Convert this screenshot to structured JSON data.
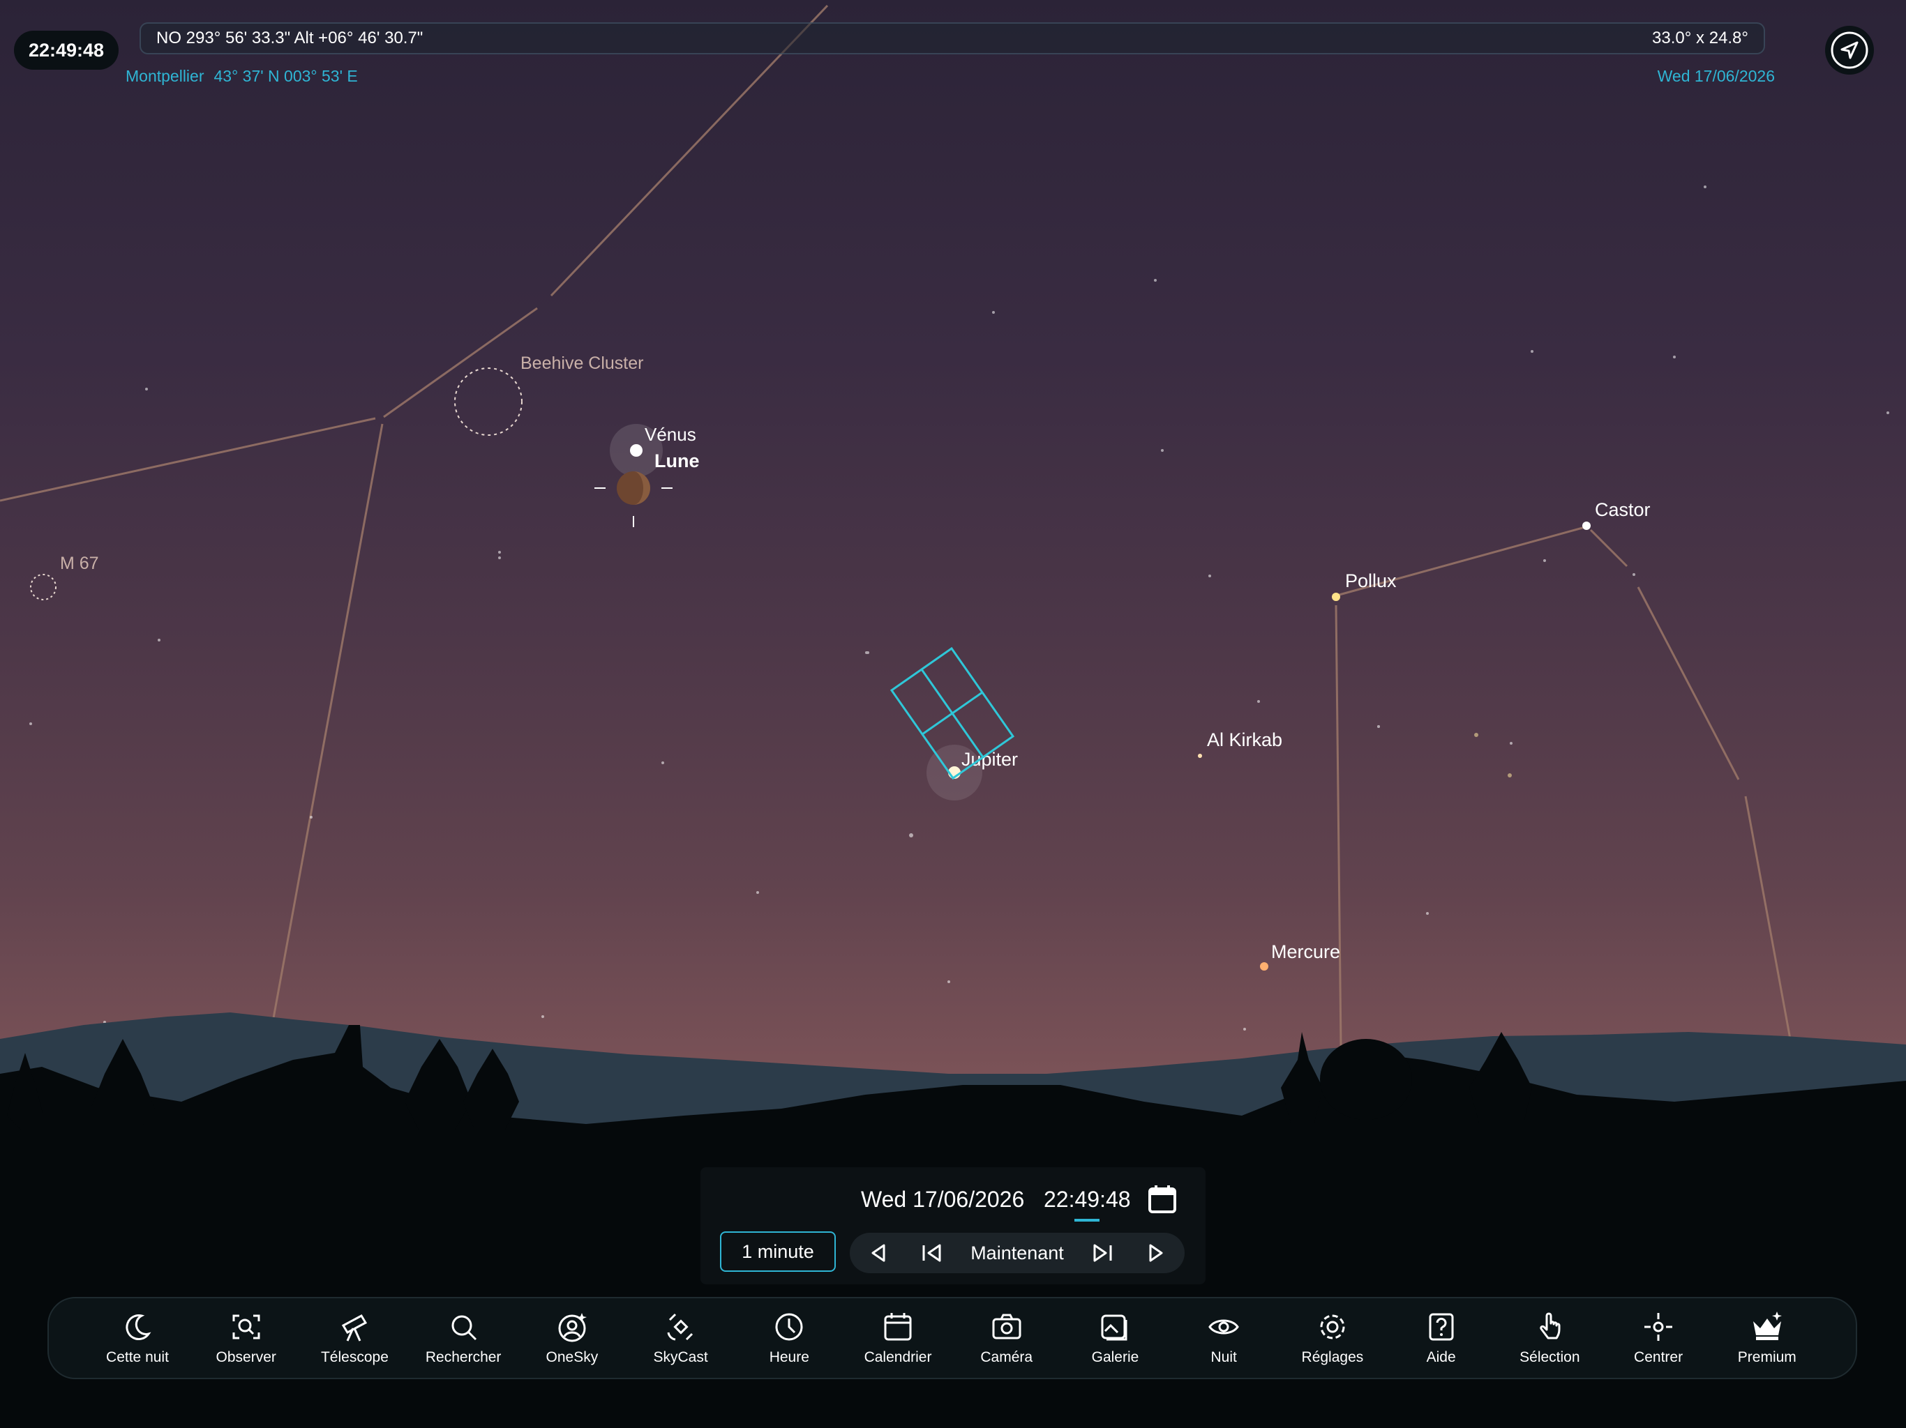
{
  "status": {
    "clock": "22:49:48"
  },
  "header": {
    "pointing": "NO 293° 56' 33.3\" Alt +06° 46' 30.7\"",
    "field_of_view": "33.0° x 24.8°",
    "location_name": "Montpellier",
    "location_coords": "43° 37' N 003° 53' E",
    "date": "Wed 17/06/2026"
  },
  "sky_labels": {
    "beehive": "Beehive Cluster",
    "m67": "M 67",
    "venus": "Vénus",
    "moon": "Lune",
    "castor": "Castor",
    "pollux": "Pollux",
    "al_kirkab": "Al Kirkab",
    "jupiter": "Jupiter",
    "mercure": "Mercure"
  },
  "time_panel": {
    "date": "Wed 17/06/2026",
    "time": "22:49:48",
    "step": "1 minute",
    "now": "Maintenant"
  },
  "toolbar": [
    {
      "label": "Cette nuit",
      "icon": "moon-icon"
    },
    {
      "label": "Observer",
      "icon": "observe-icon"
    },
    {
      "label": "Télescope",
      "icon": "telescope-icon"
    },
    {
      "label": "Rechercher",
      "icon": "search-icon"
    },
    {
      "label": "OneSky",
      "icon": "onesky-icon"
    },
    {
      "label": "SkyCast",
      "icon": "satellite-icon"
    },
    {
      "label": "Heure",
      "icon": "clock-icon"
    },
    {
      "label": "Calendrier",
      "icon": "calendar-icon"
    },
    {
      "label": "Caméra",
      "icon": "camera-icon"
    },
    {
      "label": "Galerie",
      "icon": "gallery-icon"
    },
    {
      "label": "Nuit",
      "icon": "night-eye-icon"
    },
    {
      "label": "Réglages",
      "icon": "gear-icon"
    },
    {
      "label": "Aide",
      "icon": "help-icon"
    },
    {
      "label": "Sélection",
      "icon": "hand-pointer-icon"
    },
    {
      "label": "Centrer",
      "icon": "center-target-icon"
    },
    {
      "label": "Premium",
      "icon": "crown-icon"
    }
  ],
  "colors": {
    "accent": "#2fb5d4",
    "toolbar_bg": "#0c1417",
    "constellation_line": "#a07a6a"
  }
}
